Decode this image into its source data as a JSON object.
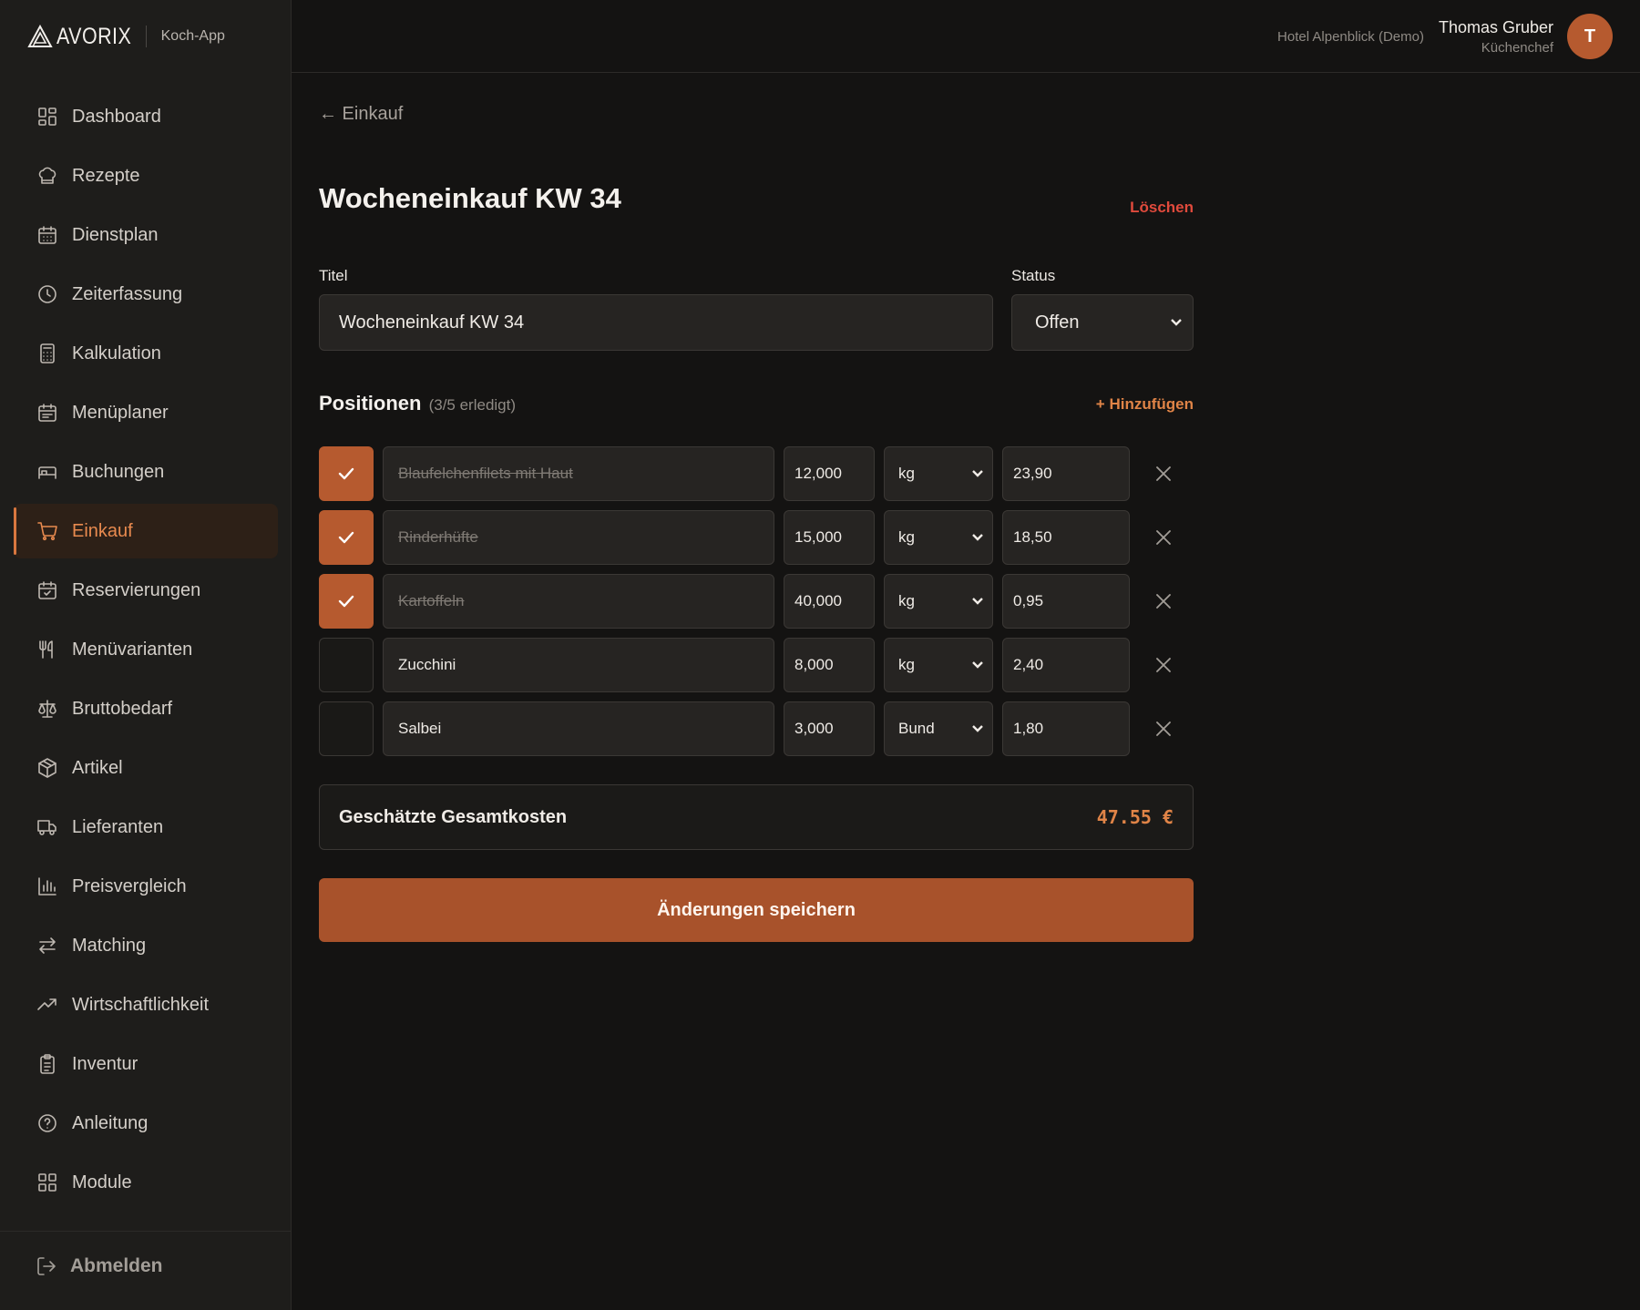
{
  "header": {
    "brand": "AVORIX",
    "app_name": "Koch-App",
    "hotel": "Hotel Alpenblick (Demo)",
    "user_name": "Thomas Gruber",
    "user_role": "Küchenchef",
    "avatar_initial": "T"
  },
  "sidebar": {
    "items": [
      {
        "label": "Dashboard",
        "icon": "dashboard-icon"
      },
      {
        "label": "Rezepte",
        "icon": "chef-hat-icon"
      },
      {
        "label": "Dienstplan",
        "icon": "calendar-icon"
      },
      {
        "label": "Zeiterfassung",
        "icon": "clock-icon"
      },
      {
        "label": "Kalkulation",
        "icon": "calculator-icon"
      },
      {
        "label": "Menüplaner",
        "icon": "calendar-list-icon"
      },
      {
        "label": "Buchungen",
        "icon": "bed-icon"
      },
      {
        "label": "Einkauf",
        "icon": "cart-icon",
        "active": true
      },
      {
        "label": "Reservierungen",
        "icon": "calendar-check-icon"
      },
      {
        "label": "Menüvarianten",
        "icon": "utensils-icon"
      },
      {
        "label": "Bruttobedarf",
        "icon": "scale-icon"
      },
      {
        "label": "Artikel",
        "icon": "package-icon"
      },
      {
        "label": "Lieferanten",
        "icon": "truck-icon"
      },
      {
        "label": "Preisvergleich",
        "icon": "bar-chart-icon"
      },
      {
        "label": "Matching",
        "icon": "arrows-exchange-icon"
      },
      {
        "label": "Wirtschaftlichkeit",
        "icon": "trend-up-icon"
      },
      {
        "label": "Inventur",
        "icon": "clipboard-icon"
      },
      {
        "label": "Anleitung",
        "icon": "help-circle-icon"
      },
      {
        "label": "Module",
        "icon": "grid-icon"
      }
    ],
    "logout": "Abmelden"
  },
  "main": {
    "back_label": "← Einkauf",
    "title": "Wocheneinkauf KW 34",
    "delete_label": "Löschen",
    "title_field_label": "Titel",
    "title_field_value": "Wocheneinkauf KW 34",
    "status_label": "Status",
    "status_value": "Offen",
    "positions_title": "Positionen",
    "positions_count": "(3/5 erledigt)",
    "add_label": "+ Hinzufügen",
    "positions": [
      {
        "done": true,
        "name": "Blaufelchenfilets mit Haut",
        "qty": "12,000",
        "unit": "kg",
        "price": "23,90"
      },
      {
        "done": true,
        "name": "Rinderhüfte",
        "qty": "15,000",
        "unit": "kg",
        "price": "18,50"
      },
      {
        "done": true,
        "name": "Kartoffeln",
        "qty": "40,000",
        "unit": "kg",
        "price": "0,95"
      },
      {
        "done": false,
        "name": "Zucchini",
        "qty": "8,000",
        "unit": "kg",
        "price": "2,40"
      },
      {
        "done": false,
        "name": "Salbei",
        "qty": "3,000",
        "unit": "Bund",
        "price": "1,80"
      }
    ],
    "total_label": "Geschätzte Gesamtkosten",
    "total_value": "47.55 €",
    "save_label": "Änderungen speichern"
  },
  "colors": {
    "accent": "#b65a2f",
    "accent_text": "#e08447",
    "danger": "#e04a3c",
    "background": "#141312",
    "sidebar": "#1e1d1b"
  }
}
